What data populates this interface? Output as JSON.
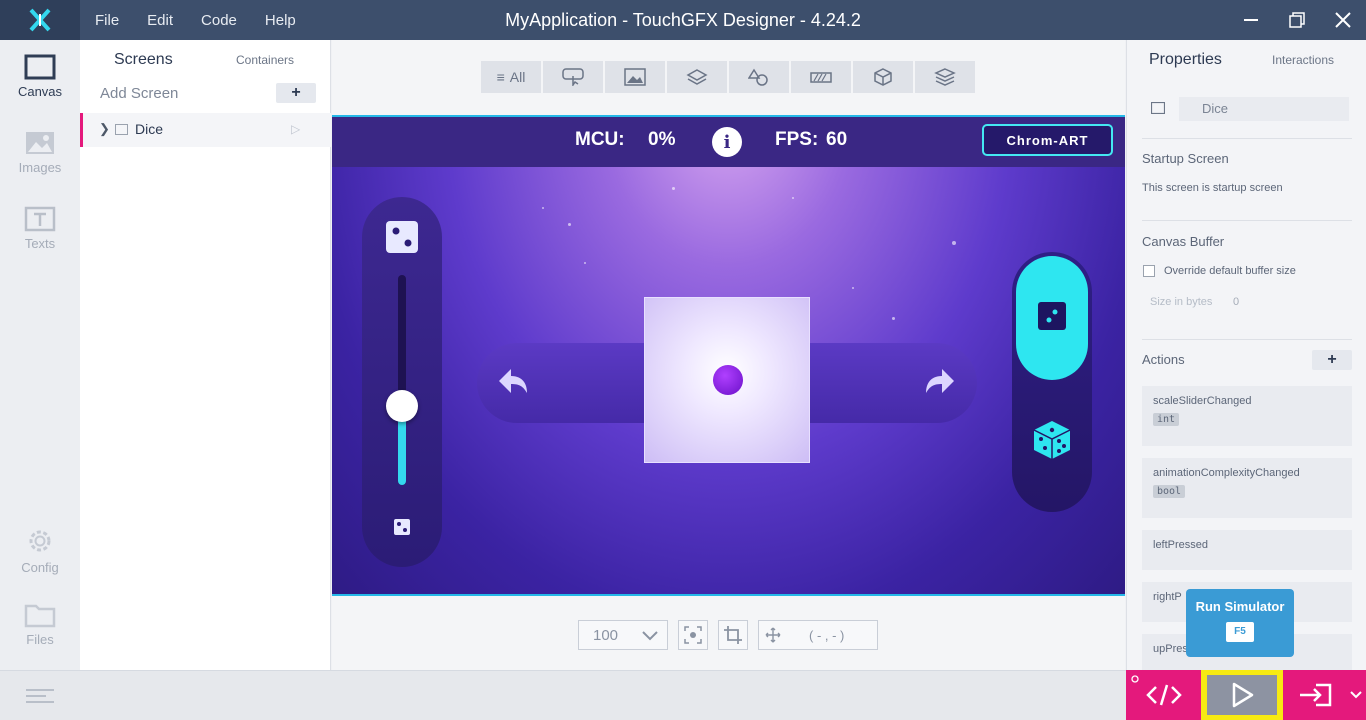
{
  "window": {
    "title": "MyApplication - TouchGFX Designer - 4.24.2",
    "menu": [
      "File",
      "Edit",
      "Code",
      "Help"
    ]
  },
  "rail": {
    "canvas": "Canvas",
    "images": "Images",
    "texts": "Texts",
    "config": "Config",
    "files": "Files"
  },
  "screens_panel": {
    "tab_screens": "Screens",
    "tab_containers": "Containers",
    "add_screen": "Add Screen",
    "plus": "+",
    "items": [
      {
        "name": "Dice"
      }
    ]
  },
  "widget_bar": {
    "all_label": "All"
  },
  "canvas_screen": {
    "mcu_label": "MCU:",
    "mcu_value": "0%",
    "info": "i",
    "fps_label": "FPS:",
    "fps_value": "60",
    "chrom_button": "Chrom-ART"
  },
  "canvas_toolbar": {
    "zoom": "100",
    "coordinates": "( - , - )"
  },
  "properties": {
    "tab_properties": "Properties",
    "tab_interactions": "Interactions",
    "name": "Dice",
    "startup_title": "Startup Screen",
    "startup_text": "This screen is startup screen",
    "buffer_title": "Canvas Buffer",
    "buffer_checkbox": "Override default buffer size",
    "size_label": "Size in bytes",
    "size_value": "0",
    "actions_title": "Actions",
    "actions_plus": "+",
    "actions": [
      {
        "name": "scaleSliderChanged",
        "type": "int"
      },
      {
        "name": "animationComplexityChanged",
        "type": "bool"
      },
      {
        "name": "leftPressed",
        "type": ""
      },
      {
        "name": "rightP",
        "type": ""
      },
      {
        "name": "upPres",
        "type": ""
      }
    ]
  },
  "tooltip": {
    "title": "Run Simulator",
    "key": "F5"
  },
  "colors": {
    "accent": "#e4197c",
    "highlight": "#f7ea12",
    "titlebar": "#3d4f6c",
    "cyan": "#2ee6f0"
  }
}
